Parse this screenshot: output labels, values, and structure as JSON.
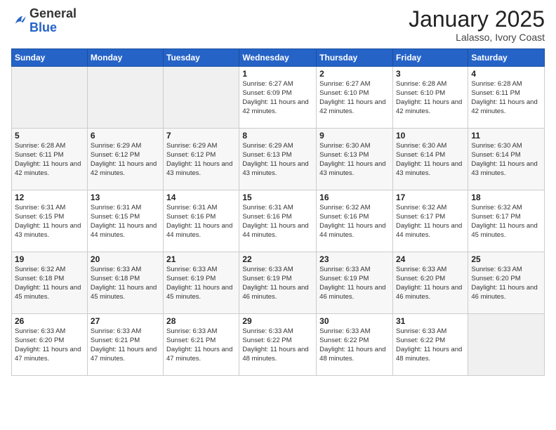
{
  "logo": {
    "general": "General",
    "blue": "Blue"
  },
  "header": {
    "month": "January 2025",
    "location": "Lalasso, Ivory Coast"
  },
  "weekdays": [
    "Sunday",
    "Monday",
    "Tuesday",
    "Wednesday",
    "Thursday",
    "Friday",
    "Saturday"
  ],
  "weeks": [
    [
      {
        "day": "",
        "sunrise": "",
        "sunset": "",
        "daylight": ""
      },
      {
        "day": "",
        "sunrise": "",
        "sunset": "",
        "daylight": ""
      },
      {
        "day": "",
        "sunrise": "",
        "sunset": "",
        "daylight": ""
      },
      {
        "day": "1",
        "sunrise": "6:27 AM",
        "sunset": "6:09 PM",
        "daylight": "11 hours and 42 minutes."
      },
      {
        "day": "2",
        "sunrise": "6:27 AM",
        "sunset": "6:10 PM",
        "daylight": "11 hours and 42 minutes."
      },
      {
        "day": "3",
        "sunrise": "6:28 AM",
        "sunset": "6:10 PM",
        "daylight": "11 hours and 42 minutes."
      },
      {
        "day": "4",
        "sunrise": "6:28 AM",
        "sunset": "6:11 PM",
        "daylight": "11 hours and 42 minutes."
      }
    ],
    [
      {
        "day": "5",
        "sunrise": "6:28 AM",
        "sunset": "6:11 PM",
        "daylight": "11 hours and 42 minutes."
      },
      {
        "day": "6",
        "sunrise": "6:29 AM",
        "sunset": "6:12 PM",
        "daylight": "11 hours and 42 minutes."
      },
      {
        "day": "7",
        "sunrise": "6:29 AM",
        "sunset": "6:12 PM",
        "daylight": "11 hours and 43 minutes."
      },
      {
        "day": "8",
        "sunrise": "6:29 AM",
        "sunset": "6:13 PM",
        "daylight": "11 hours and 43 minutes."
      },
      {
        "day": "9",
        "sunrise": "6:30 AM",
        "sunset": "6:13 PM",
        "daylight": "11 hours and 43 minutes."
      },
      {
        "day": "10",
        "sunrise": "6:30 AM",
        "sunset": "6:14 PM",
        "daylight": "11 hours and 43 minutes."
      },
      {
        "day": "11",
        "sunrise": "6:30 AM",
        "sunset": "6:14 PM",
        "daylight": "11 hours and 43 minutes."
      }
    ],
    [
      {
        "day": "12",
        "sunrise": "6:31 AM",
        "sunset": "6:15 PM",
        "daylight": "11 hours and 43 minutes."
      },
      {
        "day": "13",
        "sunrise": "6:31 AM",
        "sunset": "6:15 PM",
        "daylight": "11 hours and 44 minutes."
      },
      {
        "day": "14",
        "sunrise": "6:31 AM",
        "sunset": "6:16 PM",
        "daylight": "11 hours and 44 minutes."
      },
      {
        "day": "15",
        "sunrise": "6:31 AM",
        "sunset": "6:16 PM",
        "daylight": "11 hours and 44 minutes."
      },
      {
        "day": "16",
        "sunrise": "6:32 AM",
        "sunset": "6:16 PM",
        "daylight": "11 hours and 44 minutes."
      },
      {
        "day": "17",
        "sunrise": "6:32 AM",
        "sunset": "6:17 PM",
        "daylight": "11 hours and 44 minutes."
      },
      {
        "day": "18",
        "sunrise": "6:32 AM",
        "sunset": "6:17 PM",
        "daylight": "11 hours and 45 minutes."
      }
    ],
    [
      {
        "day": "19",
        "sunrise": "6:32 AM",
        "sunset": "6:18 PM",
        "daylight": "11 hours and 45 minutes."
      },
      {
        "day": "20",
        "sunrise": "6:33 AM",
        "sunset": "6:18 PM",
        "daylight": "11 hours and 45 minutes."
      },
      {
        "day": "21",
        "sunrise": "6:33 AM",
        "sunset": "6:19 PM",
        "daylight": "11 hours and 45 minutes."
      },
      {
        "day": "22",
        "sunrise": "6:33 AM",
        "sunset": "6:19 PM",
        "daylight": "11 hours and 46 minutes."
      },
      {
        "day": "23",
        "sunrise": "6:33 AM",
        "sunset": "6:19 PM",
        "daylight": "11 hours and 46 minutes."
      },
      {
        "day": "24",
        "sunrise": "6:33 AM",
        "sunset": "6:20 PM",
        "daylight": "11 hours and 46 minutes."
      },
      {
        "day": "25",
        "sunrise": "6:33 AM",
        "sunset": "6:20 PM",
        "daylight": "11 hours and 46 minutes."
      }
    ],
    [
      {
        "day": "26",
        "sunrise": "6:33 AM",
        "sunset": "6:20 PM",
        "daylight": "11 hours and 47 minutes."
      },
      {
        "day": "27",
        "sunrise": "6:33 AM",
        "sunset": "6:21 PM",
        "daylight": "11 hours and 47 minutes."
      },
      {
        "day": "28",
        "sunrise": "6:33 AM",
        "sunset": "6:21 PM",
        "daylight": "11 hours and 47 minutes."
      },
      {
        "day": "29",
        "sunrise": "6:33 AM",
        "sunset": "6:22 PM",
        "daylight": "11 hours and 48 minutes."
      },
      {
        "day": "30",
        "sunrise": "6:33 AM",
        "sunset": "6:22 PM",
        "daylight": "11 hours and 48 minutes."
      },
      {
        "day": "31",
        "sunrise": "6:33 AM",
        "sunset": "6:22 PM",
        "daylight": "11 hours and 48 minutes."
      },
      {
        "day": "",
        "sunrise": "",
        "sunset": "",
        "daylight": ""
      }
    ]
  ]
}
